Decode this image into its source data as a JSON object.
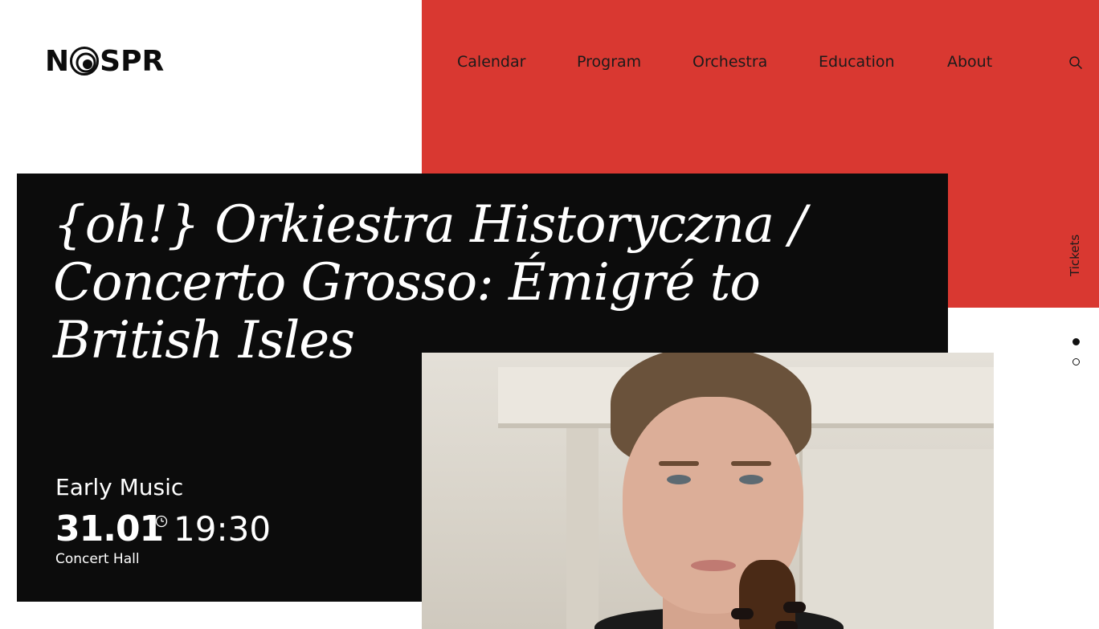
{
  "brand": {
    "logo_text_left": "N",
    "logo_text_right": "SPR",
    "accent_color": "#d93831"
  },
  "nav": {
    "items": [
      {
        "label": "Calendar"
      },
      {
        "label": "Program"
      },
      {
        "label": "Orchestra"
      },
      {
        "label": "Education"
      },
      {
        "label": "About"
      }
    ],
    "search_icon": "search-icon",
    "tickets_label": "Tickets"
  },
  "event": {
    "title": "{oh!} Orkiestra Historyczna / Concerto Grosso: Émigré to British Isles",
    "genre": "Early Music",
    "date": "31.01",
    "time": "19:30",
    "venue": "Concert Hall",
    "clock_icon": "clock-icon"
  },
  "slider": {
    "total": 2,
    "active_index": 0
  }
}
